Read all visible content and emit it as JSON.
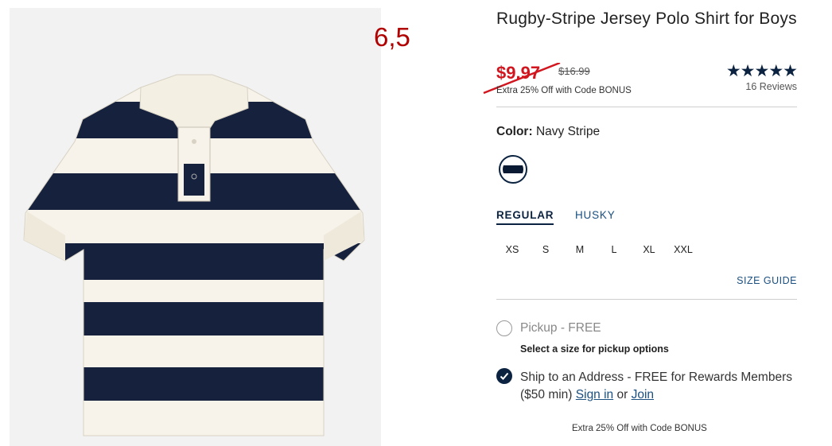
{
  "annotation": {
    "text": "6,5"
  },
  "product": {
    "title": "Rugby-Stripe Jersey Polo Shirt for Boys",
    "image_alt": "Navy and white rugby-stripe polo shirt",
    "sale_price": "$9.97",
    "original_price": "$16.99",
    "promo": "Extra 25% Off with Code BONUS",
    "rating_stars": "★★★★★",
    "rating_value": 5,
    "reviews": "16 Reviews"
  },
  "color": {
    "label": "Color:",
    "value": "Navy Stripe"
  },
  "fit_tabs": [
    {
      "label": "REGULAR",
      "selected": true
    },
    {
      "label": "HUSKY",
      "selected": false
    }
  ],
  "sizes": [
    "XS",
    "S",
    "M",
    "L",
    "XL",
    "XXL"
  ],
  "size_guide": "SIZE GUIDE",
  "fulfillment": {
    "pickup": {
      "label": "Pickup - FREE",
      "note": "Select a size for pickup options",
      "selected": false
    },
    "ship": {
      "label_prefix": "Ship to an Address - FREE for Rewards Members ($50 min)",
      "sign_in": "Sign in",
      "or": "or",
      "join": "Join",
      "selected": true
    }
  },
  "bottom_promo": "Extra 25% Off with Code BONUS",
  "colors": {
    "navy": "#0b2340",
    "sale_red": "#d1161f",
    "link_blue": "#1a4f80",
    "annotation_red": "#b00000"
  }
}
